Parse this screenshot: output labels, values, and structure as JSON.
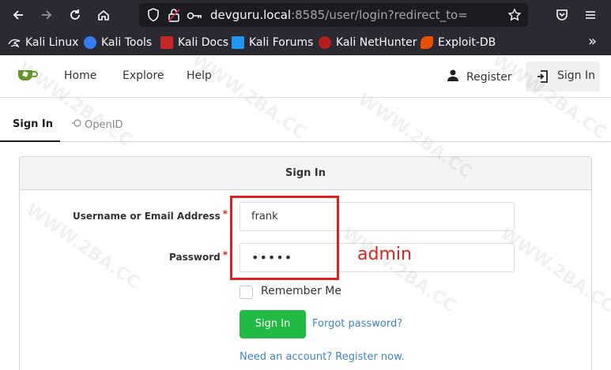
{
  "browser": {
    "url_host": "devguru.local",
    "url_rest": ":8585/user/login?redirect_to=",
    "bookmarks": [
      {
        "label": "Kali Linux",
        "icon": "kali-dragon-icon",
        "color": "#367bf0"
      },
      {
        "label": "Kali Tools",
        "icon": "kali-tools-icon",
        "color": "#e53935"
      },
      {
        "label": "Kali Docs",
        "icon": "kali-docs-icon",
        "color": "#d32f2f"
      },
      {
        "label": "Kali Forums",
        "icon": "kali-forums-icon",
        "color": "#2196f3"
      },
      {
        "label": "Kali NetHunter",
        "icon": "nethunter-icon",
        "color": "#c62828"
      },
      {
        "label": "Exploit-DB",
        "icon": "exploit-db-icon",
        "color": "#e65100"
      }
    ],
    "overflow": "»"
  },
  "nav": {
    "home": "Home",
    "explore": "Explore",
    "help": "Help",
    "register": "Register",
    "signin": "Sign In",
    "logo_color": "#609926"
  },
  "tabs": {
    "signin": "Sign In",
    "openid": "OpenID"
  },
  "form": {
    "title": "Sign In",
    "username_label": "Username or Email Address",
    "username_value": "frank",
    "password_label": "Password",
    "password_value": "•••••",
    "required_mark": "*",
    "remember_label": "Remember Me",
    "signin_button": "Sign In",
    "forgot_link": "Forgot password?",
    "register_link": "Need an account? Register now."
  },
  "annotation": {
    "text": "admin",
    "color": "#e02020"
  },
  "watermark": "WWW.2BA.CC"
}
